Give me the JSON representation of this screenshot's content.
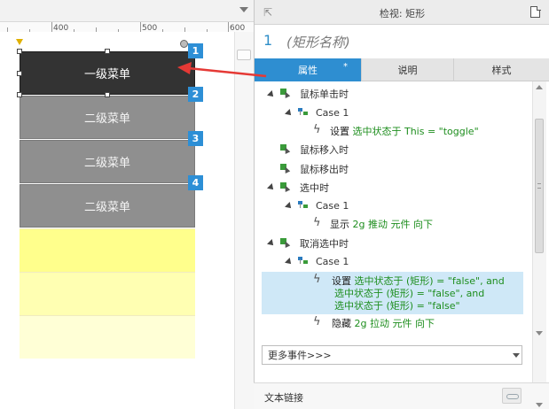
{
  "canvas": {
    "ruler": {
      "labels": [
        "400",
        "500",
        "600"
      ]
    },
    "menu": {
      "level1": "一级菜单",
      "level2": [
        "二级菜单",
        "二级菜单",
        "二级菜单"
      ]
    },
    "badges": [
      "1",
      "2",
      "3",
      "4"
    ],
    "colors": {
      "level1": "#333333",
      "level2": "#8f8f8f",
      "badge": "#2d8fd6",
      "arrow": "#e53935"
    }
  },
  "inspector": {
    "title": "检视: 矩形",
    "name_number": "1",
    "name_placeholder": "(矩形名称)",
    "tabs": {
      "properties": "属性",
      "properties_star": "*",
      "notes": "说明",
      "style": "样式"
    },
    "events": {
      "click": {
        "label": "鼠标单击时",
        "case": "Case 1",
        "action": {
          "verb": "设置",
          "detail": "选中状态于 This = \"toggle\""
        }
      },
      "mouse_enter": "鼠标移入时",
      "mouse_leave": "鼠标移出时",
      "selected": {
        "label": "选中时",
        "case": "Case 1",
        "action": {
          "verb": "显示",
          "detail": "2g 推动 元件 向下"
        }
      },
      "unselected": {
        "label": "取消选中时",
        "case": "Case 1",
        "action_set": {
          "verb": "设置",
          "line1": "选中状态于 (矩形) = \"false\", and",
          "line2": "选中状态于 (矩形) = \"false\", and",
          "line3": "选中状态于 (矩形) = \"false\""
        },
        "action_hide": {
          "verb": "隐藏",
          "detail": "2g 拉动 元件 向下"
        }
      }
    },
    "more_events": "更多事件>>>",
    "text_link": "文本链接",
    "colors": {
      "tab_active": "#2e8ed1",
      "highlight": "#cfe8f7",
      "action_text": "#1e8e1e"
    }
  }
}
